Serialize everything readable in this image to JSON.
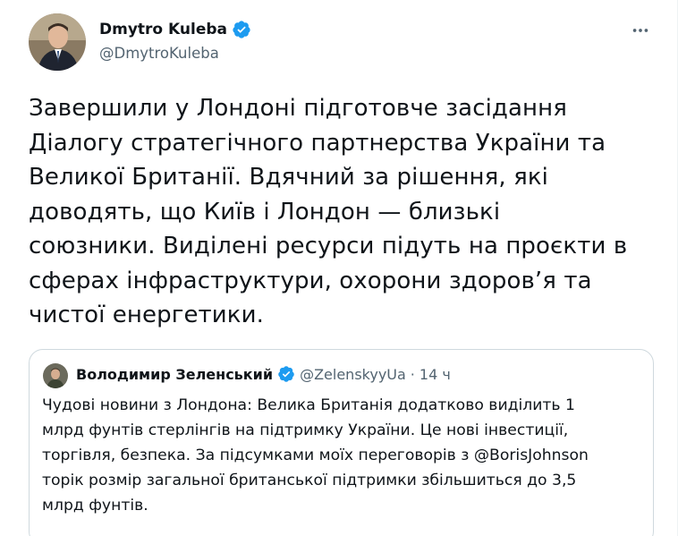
{
  "author": {
    "display_name": "Dmytro Kuleba",
    "handle": "@DmytroKuleba",
    "verified": true,
    "avatar_icon": "profile-photo"
  },
  "more_icon": "more-horizontal-icon",
  "tweet": {
    "text": "Завершили у Лондоні підготовче засідання\nДіалогу стратегічного партнерства України та\nВеликої Британії. Вдячний за рішення, які\nдоводять, що Київ і Лондон — близькі\nсоюзники. Виділені ресурси підуть на проєкти в\nсферах інфраструктури, охорони здоров’я та\nчистої енергетики."
  },
  "quoted_tweet": {
    "display_name": "Володимир Зеленський",
    "handle": "@ZelenskyyUa",
    "separator": "·",
    "time": "14 ч",
    "verified": true,
    "text": "Чудові новини з Лондона: Велика Британія додатково виділить 1\nмлрд фунтів стерлінгів на підтримку України. Це нові інвестиції,\nторгівля, безпека. За підсумками моїх переговорів з @BorisJohnson\nторік розмір загальної британської підтримки збільшиться до 3,5\nмлрд фунтів."
  },
  "colors": {
    "text_primary": "#0f1419",
    "text_secondary": "#536471",
    "verified_blue": "#1d9bf0",
    "border": "#cfd9de"
  }
}
